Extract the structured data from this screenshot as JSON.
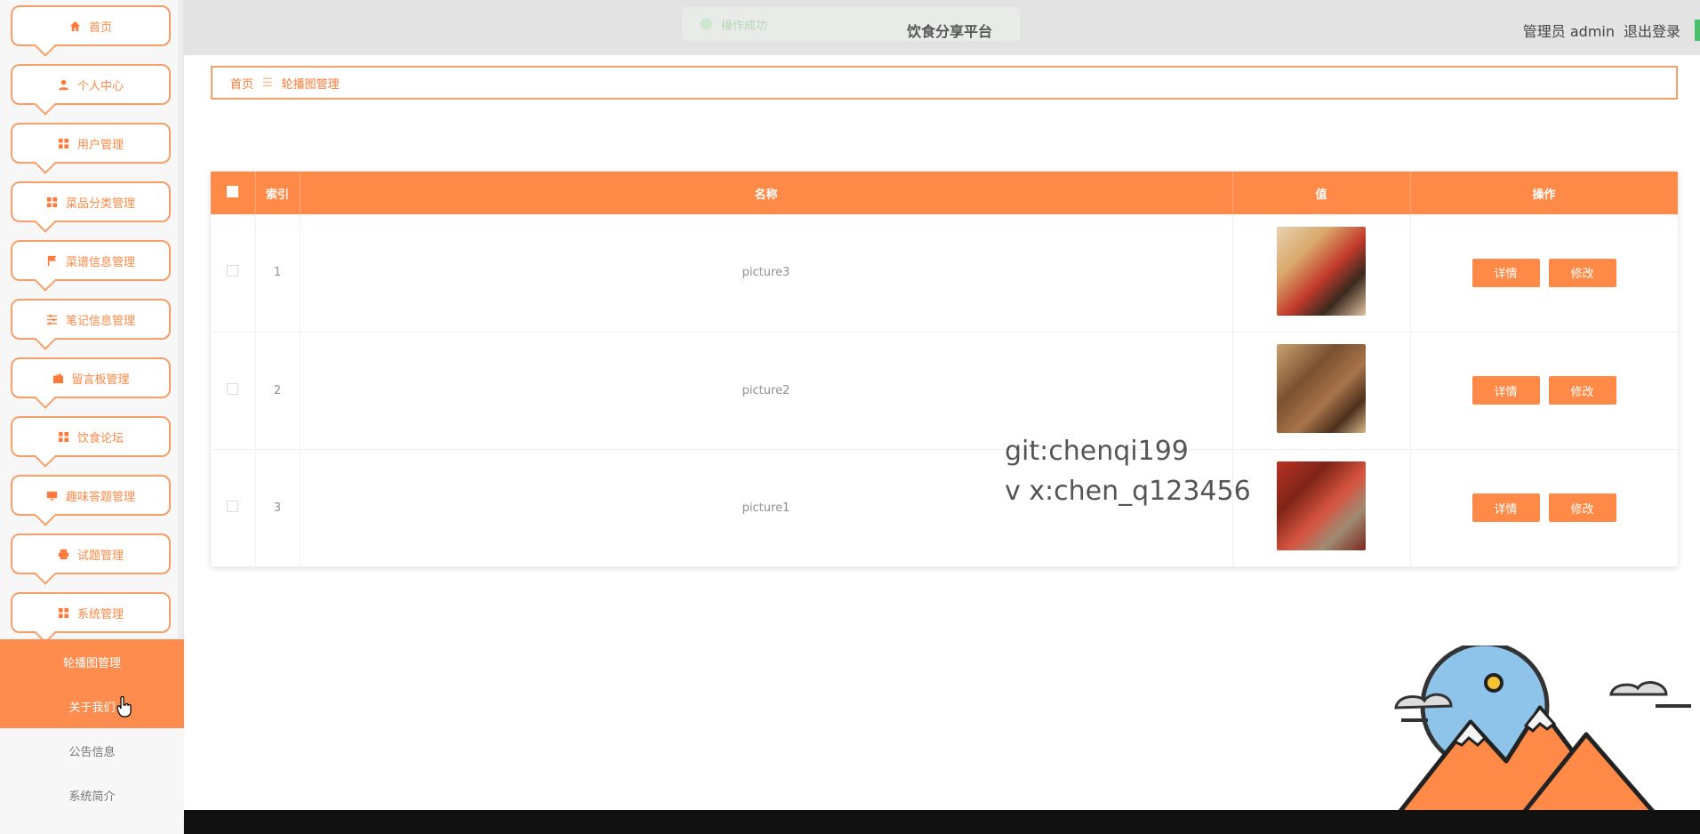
{
  "app": {
    "title": "饮食分享平台"
  },
  "toast": {
    "message": "操作成功"
  },
  "header": {
    "admin_label": "管理员 admin",
    "logout_label": "退出登录"
  },
  "sidebar": {
    "items": [
      {
        "label": "首页",
        "icon": "home-icon"
      },
      {
        "label": "个人中心",
        "icon": "user-icon"
      },
      {
        "label": "用户管理",
        "icon": "grid-icon"
      },
      {
        "label": "菜品分类管理",
        "icon": "grid-icon"
      },
      {
        "label": "菜谱信息管理",
        "icon": "flag-icon"
      },
      {
        "label": "笔记信息管理",
        "icon": "sliders-icon"
      },
      {
        "label": "留言板管理",
        "icon": "wallet-icon"
      },
      {
        "label": "饮食论坛",
        "icon": "grid-icon"
      },
      {
        "label": "趣味答题管理",
        "icon": "monitor-icon"
      },
      {
        "label": "试题管理",
        "icon": "printer-icon"
      },
      {
        "label": "系统管理",
        "icon": "grid-icon"
      }
    ],
    "sub_items": [
      {
        "label": "轮播图管理",
        "active": true
      },
      {
        "label": "关于我们",
        "active": true
      },
      {
        "label": "公告信息",
        "active": false
      },
      {
        "label": "系统简介",
        "active": false
      }
    ]
  },
  "breadcrumb": {
    "home": "首页",
    "separator": "☰",
    "current": "轮播图管理"
  },
  "table": {
    "columns": [
      "",
      "索引",
      "名称",
      "值",
      "操作"
    ],
    "rows": [
      {
        "index": "1",
        "name": "picture3",
        "image": "food-photo-1"
      },
      {
        "index": "2",
        "name": "picture2",
        "image": "food-photo-2"
      },
      {
        "index": "3",
        "name": "picture1",
        "image": "food-photo-3"
      }
    ],
    "detail_label": "详情",
    "edit_label": "修改"
  },
  "watermark": {
    "line1": "git:chenqi199",
    "line2": "v x:chen_q123456"
  },
  "colors": {
    "accent": "#ff8a48",
    "border": "#f4a06a",
    "topbar": "#e3e3e3"
  }
}
